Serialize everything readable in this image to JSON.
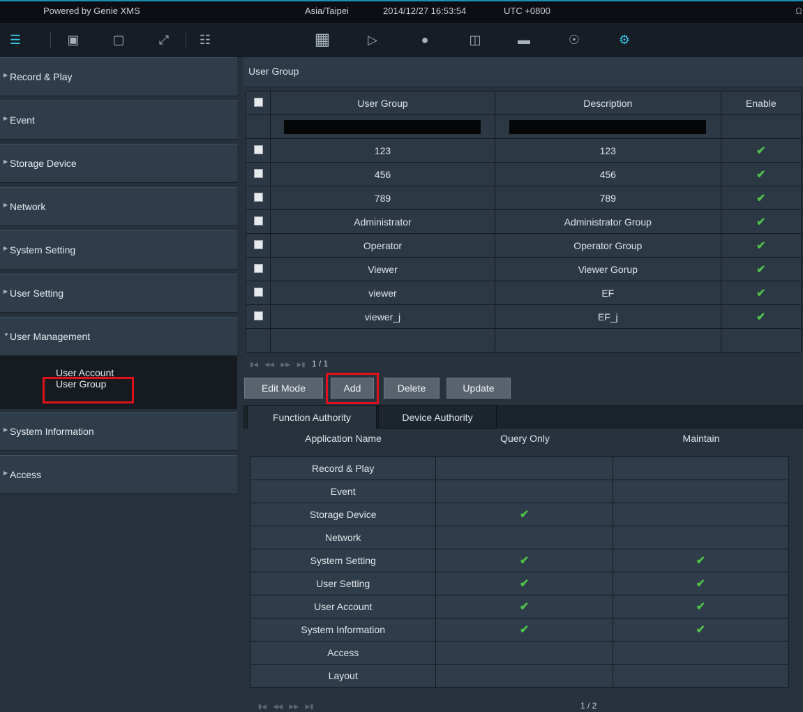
{
  "topbar": {
    "powered": "Powered by Genie XMS",
    "timezone": "Asia/Taipei",
    "datetime": "2014/12/27 16:53:54",
    "utc": "UTC +0800"
  },
  "toolbar": {
    "left_icons": [
      "list-view-icon",
      "window-stack-icon",
      "monitor-icon",
      "fullscreen-icon",
      "grid-split-icon"
    ],
    "right_icons": [
      "layout-icon",
      "playback-icon",
      "alert-icon",
      "lock-icon",
      "vehicle-icon",
      "device-icon",
      "settings-icon"
    ],
    "active_color": "#37c9e8"
  },
  "sidebar": {
    "items": [
      {
        "label": "Record & Play"
      },
      {
        "label": "Event"
      },
      {
        "label": "Storage Device"
      },
      {
        "label": "Network"
      },
      {
        "label": "System Setting"
      },
      {
        "label": "User Setting"
      },
      {
        "label": "User Management"
      },
      {
        "label": "System Information"
      },
      {
        "label": "Access"
      }
    ],
    "sub_items": [
      "User Account",
      "User Group"
    ],
    "selected": "User Group"
  },
  "panel": {
    "title": "User Group",
    "columns": [
      "User Group",
      "Description",
      "Enable"
    ],
    "rows": [
      {
        "group": "123",
        "description": "123",
        "enabled": true
      },
      {
        "group": "456",
        "description": "456",
        "enabled": true
      },
      {
        "group": "789",
        "description": "789",
        "enabled": true
      },
      {
        "group": "Administrator",
        "description": "Administrator Group",
        "enabled": true
      },
      {
        "group": "Operator",
        "description": "Operator Group",
        "enabled": true
      },
      {
        "group": "Viewer",
        "description": "Viewer Gorup",
        "enabled": true
      },
      {
        "group": "viewer",
        "description": "EF",
        "enabled": true
      },
      {
        "group": "viewer_j",
        "description": "EF_j",
        "enabled": true
      }
    ],
    "page": "1 / 1",
    "buttons": {
      "edit": "Edit Mode",
      "add": "Add",
      "delete": "Delete",
      "update": "Update"
    },
    "tabs": [
      "Function Authority",
      "Device Authority"
    ],
    "auth_columns": [
      "Application Name",
      "Query Only",
      "Maintain"
    ],
    "auth_rows": [
      {
        "name": "Record & Play",
        "query": false,
        "maintain": false
      },
      {
        "name": "Event",
        "query": false,
        "maintain": false
      },
      {
        "name": "Storage Device",
        "query": true,
        "maintain": false
      },
      {
        "name": "Network",
        "query": false,
        "maintain": false
      },
      {
        "name": "System Setting",
        "query": true,
        "maintain": true
      },
      {
        "name": "User Setting",
        "query": true,
        "maintain": true
      },
      {
        "name": "User Account",
        "query": true,
        "maintain": true
      },
      {
        "name": "System Information",
        "query": true,
        "maintain": true
      },
      {
        "name": "Access",
        "query": false,
        "maintain": false
      },
      {
        "name": "Layout",
        "query": false,
        "maintain": false
      }
    ],
    "auth_page": "1 / 2"
  },
  "colors": {
    "highlight": "#e1111a",
    "check": "#4fc24a",
    "accent": "#1a8fb3"
  }
}
